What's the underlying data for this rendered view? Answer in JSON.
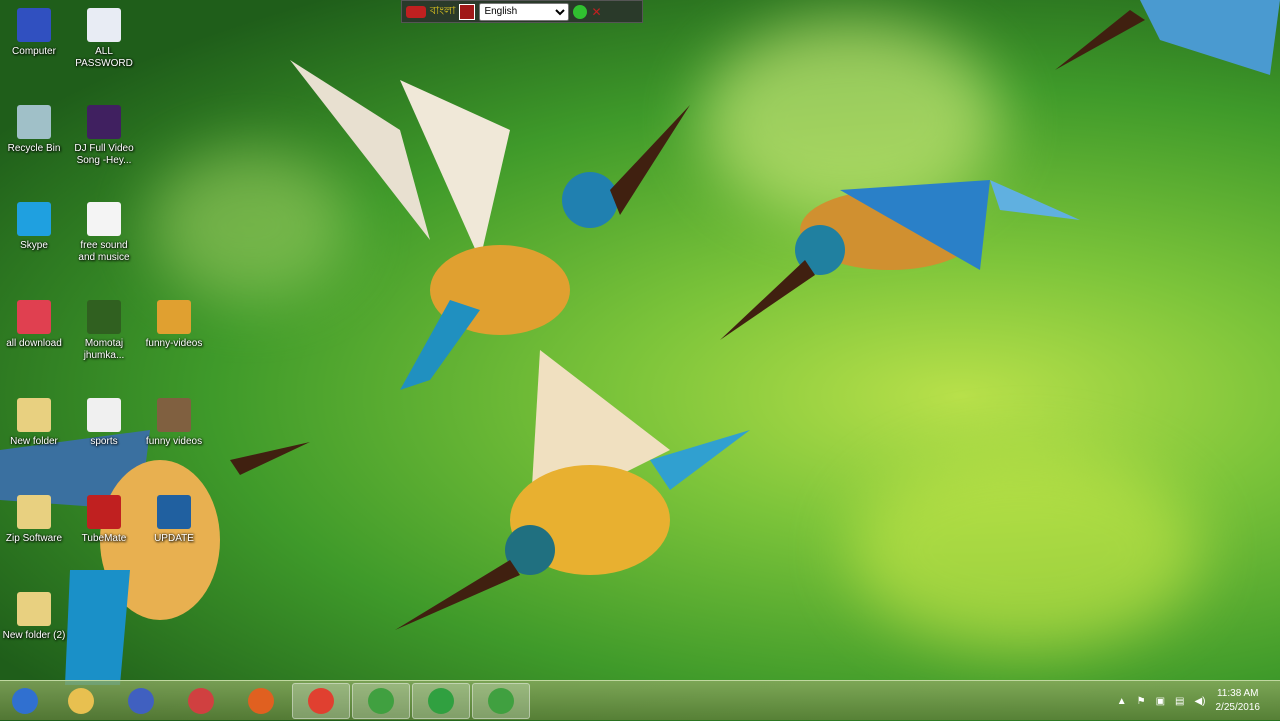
{
  "language_bar": {
    "script_label": "বাংলা",
    "language": "English"
  },
  "desktop_icons": [
    {
      "label": "Computer",
      "color": "#3050c0"
    },
    {
      "label": "ALL PASSWORD",
      "color": "#e8ecf4"
    },
    {
      "label": "Recycle Bin",
      "color": "#a0c0c8"
    },
    {
      "label": "DJ Full Video Song -Hey...",
      "color": "#402060"
    },
    {
      "label": "Skype",
      "color": "#1fa0e0"
    },
    {
      "label": "free sound and musice",
      "color": "#f4f4f4"
    },
    {
      "label": "all download",
      "color": "#e04050"
    },
    {
      "label": "Momotaj jhumka...",
      "color": "#306020"
    },
    {
      "label": "funny-videos",
      "color": "#e0a030"
    },
    {
      "label": "New folder",
      "color": "#e8d080"
    },
    {
      "label": "sports",
      "color": "#f0f0f0"
    },
    {
      "label": "funny videos",
      "color": "#806040"
    },
    {
      "label": "Zip Software",
      "color": "#e8d080"
    },
    {
      "label": "TubeMate",
      "color": "#c02020"
    },
    {
      "label": "UPDATE",
      "color": "#2060a0"
    },
    {
      "label": "New folder (2)",
      "color": "#e8d080"
    }
  ],
  "taskbar": {
    "items": [
      {
        "name": "start",
        "color": "#3070d0"
      },
      {
        "name": "file-explorer",
        "color": "#e8c050"
      },
      {
        "name": "app",
        "color": "#4060c0"
      },
      {
        "name": "snipping-tool",
        "color": "#d04040"
      },
      {
        "name": "firefox",
        "color": "#e06020"
      },
      {
        "name": "chrome",
        "color": "#e04030"
      },
      {
        "name": "camtasia",
        "color": "#40a040"
      },
      {
        "name": "internet-explorer",
        "color": "#30a040"
      },
      {
        "name": "camtasia-2",
        "color": "#40a040"
      }
    ],
    "time": "11:38 AM",
    "date": "2/25/2016"
  }
}
